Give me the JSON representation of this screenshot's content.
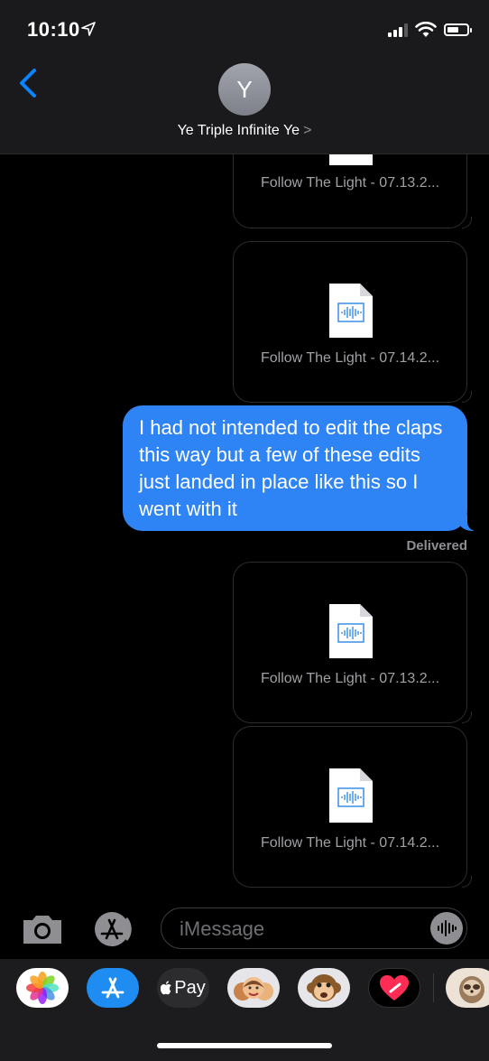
{
  "status": {
    "time": "10:10"
  },
  "header": {
    "avatar_initial": "Y",
    "contact_name": "Ye Triple Infinite Ye",
    "contact_chevron": ">"
  },
  "messages": {
    "files": [
      {
        "name": "Follow The Light - 07.13.2..."
      },
      {
        "name": "Follow The Light - 07.14.2..."
      },
      {
        "name": "Follow The Light - 07.13.2..."
      },
      {
        "name": "Follow The Light - 07.14.2..."
      }
    ],
    "text_message": "I had not intended to edit the claps this way but a few of these edits just landed in place like this so I went with it",
    "delivered_label": "Delivered"
  },
  "composer": {
    "placeholder": "iMessage"
  },
  "drawer": {
    "apple_pay_label": "Pay"
  },
  "colors": {
    "accent": "#0a84ff",
    "sent_bubble": "#2f84f5",
    "background": "#000000"
  }
}
